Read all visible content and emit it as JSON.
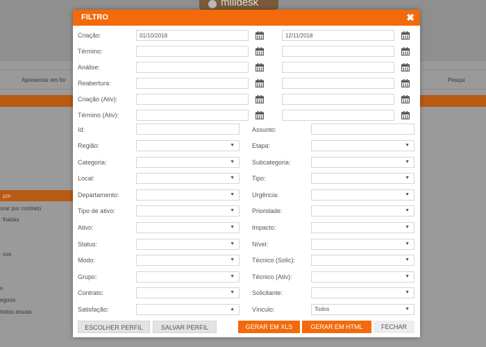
{
  "background": {
    "logo_text": "milldesk",
    "apresentar": "Apresentar em for",
    "pesquisar": "Pesqui",
    "side_items": [
      "por",
      "orar por contrato",
      "lhadas",
      "cos",
      "o",
      "egoria",
      "tratos anuais"
    ]
  },
  "modal": {
    "title": "FILTRO",
    "close": "✖"
  },
  "dates": [
    {
      "label": "Criação:",
      "from": "01/10/2018",
      "to": "12/11/2018"
    },
    {
      "label": "Término:",
      "from": "",
      "to": ""
    },
    {
      "label": "Análise:",
      "from": "",
      "to": ""
    },
    {
      "label": "Reabertura:",
      "from": "",
      "to": ""
    },
    {
      "label": "Criação (Ativ):",
      "from": "",
      "to": ""
    },
    {
      "label": "Término (Ativ):",
      "from": "",
      "to": ""
    }
  ],
  "text_fields": {
    "id_label": "Id:",
    "id_value": "",
    "assunto_label": "Assunto:",
    "assunto_value": ""
  },
  "selects_left": [
    {
      "label": "Região:",
      "value": ""
    },
    {
      "label": "Categoria:",
      "value": ""
    },
    {
      "label": "Local:",
      "value": ""
    },
    {
      "label": "Departamento:",
      "value": ""
    },
    {
      "label": "Tipo de ativo:",
      "value": ""
    },
    {
      "label": "Ativo:",
      "value": ""
    },
    {
      "label": "Status:",
      "value": ""
    },
    {
      "label": "Modo:",
      "value": ""
    },
    {
      "label": "Grupo:",
      "value": ""
    },
    {
      "label": "Contrato:",
      "value": ""
    },
    {
      "label": "Satisfação:",
      "value": ""
    }
  ],
  "selects_right": [
    {
      "label": "Etapa:",
      "value": ""
    },
    {
      "label": "Subcategoria:",
      "value": ""
    },
    {
      "label": "Tipo:",
      "value": ""
    },
    {
      "label": "Urgência:",
      "value": ""
    },
    {
      "label": "Prioridade:",
      "value": ""
    },
    {
      "label": "Impacto:",
      "value": ""
    },
    {
      "label": "Nível:",
      "value": ""
    },
    {
      "label": "Técnico (Solic):",
      "value": ""
    },
    {
      "label": "Técnico (Ativ):",
      "value": ""
    },
    {
      "label": "Solicitante:",
      "value": ""
    },
    {
      "label": "Vínculo:",
      "value": "Todos"
    }
  ],
  "buttons": {
    "escolher": "ESCOLHER PERFIL",
    "salvar": "SALVAR PERFIL",
    "xls": "GERAR EM XLS",
    "html": "GERAR EM HTML",
    "fechar": "FECHAR"
  },
  "colors": {
    "accent": "#f26a0c"
  }
}
